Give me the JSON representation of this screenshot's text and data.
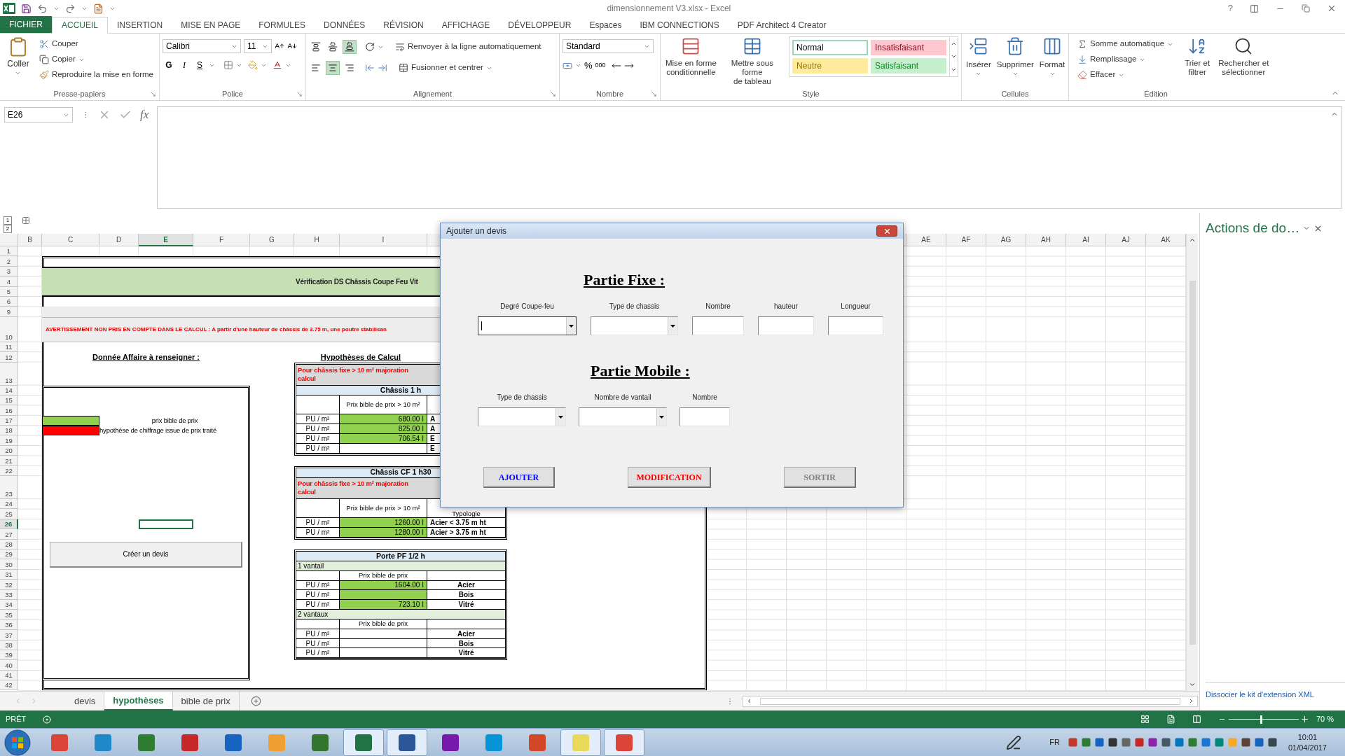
{
  "window": {
    "title": "dimensionnement V3.xlsx - Excel",
    "help": "?"
  },
  "ribbon_tabs": [
    {
      "label": "FICHIER",
      "kind": "file",
      "selected": false
    },
    {
      "label": "ACCUEIL",
      "kind": "tab",
      "selected": true
    },
    {
      "label": "INSERTION",
      "kind": "tab",
      "selected": false
    },
    {
      "label": "MISE EN PAGE",
      "kind": "tab",
      "selected": false
    },
    {
      "label": "FORMULES",
      "kind": "tab",
      "selected": false
    },
    {
      "label": "DONNÉES",
      "kind": "tab",
      "selected": false
    },
    {
      "label": "RÉVISION",
      "kind": "tab",
      "selected": false
    },
    {
      "label": "AFFICHAGE",
      "kind": "tab",
      "selected": false
    },
    {
      "label": "DÉVELOPPEUR",
      "kind": "tab",
      "selected": false
    },
    {
      "label": "Espaces",
      "kind": "tab",
      "selected": false
    },
    {
      "label": "IBM CONNECTIONS",
      "kind": "tab",
      "selected": false
    },
    {
      "label": "PDF Architect 4 Creator",
      "kind": "tab",
      "selected": false
    }
  ],
  "ribbon": {
    "clipboard": {
      "group": "Presse-papiers",
      "paste": "Coller",
      "cut": "Couper",
      "copy": "Copier",
      "format_painter": "Reproduire la mise en forme"
    },
    "font": {
      "group": "Police",
      "family": "Calibri",
      "size": "11",
      "bold": "G",
      "italic": "I",
      "underline": "S"
    },
    "alignment": {
      "group": "Alignement",
      "wrap": "Renvoyer à la ligne automatiquement",
      "merge": "Fusionner et centrer",
      "vertical": [
        {
          "selected": false
        },
        {
          "selected": false
        },
        {
          "selected": true
        }
      ],
      "horizontal": [
        {
          "selected": false
        },
        {
          "selected": true
        },
        {
          "selected": false
        }
      ]
    },
    "number": {
      "group": "Nombre",
      "format": "Standard",
      "percent": "%",
      "thousands": "000"
    },
    "style": {
      "group": "Style",
      "conditional": [
        "Mise en forme",
        "conditionnelle"
      ],
      "table": [
        "Mettre sous forme",
        "de tableau"
      ],
      "gallery": [
        {
          "label": "Normal",
          "color": "#ffffff",
          "selected": true
        },
        {
          "label": "Insatisfaisant",
          "color": "#ffc7ce",
          "selected": false
        },
        {
          "label": "Neutre",
          "color": "#ffeb9c",
          "selected": false
        },
        {
          "label": "Satisfaisant",
          "color": "#c6efce",
          "selected": false
        }
      ]
    },
    "cells": {
      "group": "Cellules",
      "insert": "Insérer",
      "delete": "Supprimer",
      "format": "Format"
    },
    "editing": {
      "group": "Édition",
      "autosum": "Somme automatique",
      "fill": "Remplissage",
      "clear": "Effacer",
      "sort": [
        "Trier et",
        "filtrer"
      ],
      "find": [
        "Rechercher et",
        "sélectionner"
      ]
    }
  },
  "formula_bar": {
    "name_box": "E26",
    "fx": "fx"
  },
  "outline_levels": [
    "1",
    "2"
  ],
  "sheet": {
    "columns": [
      {
        "label": "B",
        "selected": false
      },
      {
        "label": "C",
        "selected": false
      },
      {
        "label": "D",
        "selected": false
      },
      {
        "label": "E",
        "selected": true
      },
      {
        "label": "F",
        "selected": false
      },
      {
        "label": "G",
        "selected": false
      },
      {
        "label": "H",
        "selected": false
      },
      {
        "label": "I",
        "selected": false
      },
      {
        "label": "AE",
        "selected": false
      },
      {
        "label": "AF",
        "selected": false
      },
      {
        "label": "AG",
        "selected": false
      },
      {
        "label": "AH",
        "selected": false
      },
      {
        "label": "AI",
        "selected": false
      },
      {
        "label": "AJ",
        "selected": false
      },
      {
        "label": "AK",
        "selected": false
      }
    ],
    "rows": [
      {
        "label": "1",
        "selected": false
      },
      {
        "label": "2",
        "selected": false
      },
      {
        "label": "3",
        "selected": false
      },
      {
        "label": "4",
        "selected": false
      },
      {
        "label": "5",
        "selected": false
      },
      {
        "label": "6",
        "selected": false
      },
      {
        "label": "9",
        "selected": false
      },
      {
        "label": "10",
        "selected": false
      },
      {
        "label": "11",
        "selected": false
      },
      {
        "label": "12",
        "selected": false
      },
      {
        "label": "13",
        "selected": false
      },
      {
        "label": "14",
        "selected": false
      },
      {
        "label": "15",
        "selected": false
      },
      {
        "label": "16",
        "selected": false
      },
      {
        "label": "17",
        "selected": false
      },
      {
        "label": "18",
        "selected": false
      },
      {
        "label": "19",
        "selected": false
      },
      {
        "label": "20",
        "selected": false
      },
      {
        "label": "21",
        "selected": false
      },
      {
        "label": "22",
        "selected": false
      },
      {
        "label": "23",
        "selected": false
      },
      {
        "label": "24",
        "selected": false
      },
      {
        "label": "25",
        "selected": false
      },
      {
        "label": "26",
        "selected": true
      },
      {
        "label": "27",
        "selected": false
      },
      {
        "label": "28",
        "selected": false
      },
      {
        "label": "29",
        "selected": false
      },
      {
        "label": "30",
        "selected": false
      },
      {
        "label": "31",
        "selected": false
      },
      {
        "label": "32",
        "selected": false
      },
      {
        "label": "33",
        "selected": false
      },
      {
        "label": "34",
        "selected": false
      },
      {
        "label": "35",
        "selected": false
      },
      {
        "label": "36",
        "selected": false
      },
      {
        "label": "37",
        "selected": false
      },
      {
        "label": "38",
        "selected": false
      },
      {
        "label": "39",
        "selected": false
      },
      {
        "label": "40",
        "selected": false
      },
      {
        "label": "41",
        "selected": false
      },
      {
        "label": "42",
        "selected": false
      }
    ],
    "title_band": "Vérification DS Châssis Coupe Feu Vit",
    "warning": "AVERTISSEMENT NON PRIS EN COMPTE DANS LE CALCUL : A partir d'une hauteur de châssis de 3.75 m, une poutre stabilisan",
    "affaire_heading": "Donnée Affaire à renseigner :",
    "hypotheses_heading": "Hypothèses de Calcul",
    "legend": [
      {
        "color": "#92d050",
        "label": "prix bible de prix"
      },
      {
        "color": "#ff0000",
        "label": "hypothèse de chiffrage issue de prix traité"
      }
    ],
    "create_button": "Créer un devis",
    "tables": [
      {
        "kind": "price",
        "parts": [
          {
            "kind": "note",
            "lines": [
              "Pour châssis fixe > 10 m² majoration",
              "calcul"
            ]
          },
          {
            "kind": "title",
            "text": "Châssis 1 h"
          },
          {
            "kind": "header",
            "text": "Prix bible de prix > 10 m²"
          },
          {
            "kind": "row",
            "unit": "PU / m²",
            "value": "680.00 I",
            "type": "A",
            "color": "#92d050"
          },
          {
            "kind": "row",
            "unit": "PU / m²",
            "value": "825.00 I",
            "type": "A",
            "color": "#92d050"
          },
          {
            "kind": "row",
            "unit": "PU / m²",
            "value": "706.54 I",
            "type": "E",
            "color": "#92d050"
          },
          {
            "kind": "row",
            "unit": "PU / m²",
            "type": "E"
          }
        ]
      },
      {
        "kind": "price",
        "parts": [
          {
            "kind": "title",
            "text": "Châssis CF 1 h30"
          },
          {
            "kind": "note",
            "lines": [
              "Pour châssis fixe > 10 m² majoration",
              "calcul"
            ]
          },
          {
            "kind": "header",
            "text": "Prix bible de prix > 10 m²",
            "typology": "Typologie"
          },
          {
            "kind": "row",
            "unit": "PU / m²",
            "value": "1260.00 I",
            "type": "Acier < 3.75 m ht",
            "color": "#92d050"
          },
          {
            "kind": "row",
            "unit": "PU / m²",
            "value": "1280.00 I",
            "type": "Acier > 3.75 m ht",
            "color": "#92d050"
          }
        ]
      },
      {
        "kind": "door",
        "parts": [
          {
            "kind": "title",
            "text": "Porte PF 1/2 h"
          },
          {
            "kind": "section",
            "text": "1 vantail"
          },
          {
            "kind": "header",
            "text": "Prix bible de prix"
          },
          {
            "kind": "row",
            "unit": "PU / m²",
            "value": "1604.00 I",
            "type": "Acier",
            "color": "#92d050"
          },
          {
            "kind": "row",
            "unit": "PU / m²",
            "type": "Bois",
            "color": "#92d050"
          },
          {
            "kind": "row",
            "unit": "PU / m²",
            "value": "723.10 I",
            "type": "Vitré",
            "color": "#92d050"
          },
          {
            "kind": "section",
            "text": "2 vantaux"
          },
          {
            "kind": "header",
            "text": "Prix bible de prix"
          },
          {
            "kind": "row",
            "unit": "PU / m²",
            "type": "Acier"
          },
          {
            "kind": "row",
            "unit": "PU / m²",
            "type": "Bois"
          },
          {
            "kind": "row",
            "unit": "PU / m²",
            "type": "Vitré"
          }
        ]
      }
    ]
  },
  "dialog": {
    "title": "Ajouter un devis",
    "sections": [
      {
        "heading": "Partie Fixe :",
        "fields": [
          {
            "label": "Degré Coupe-feu",
            "kind": "combo",
            "focused": true
          },
          {
            "label": "Type de chassis",
            "kind": "combo",
            "focused": false
          },
          {
            "label": "Nombre",
            "kind": "text",
            "focused": false
          },
          {
            "label": "hauteur",
            "kind": "text",
            "focused": false
          },
          {
            "label": "Longueur",
            "kind": "text",
            "focused": false
          }
        ]
      },
      {
        "heading": "Partie Mobile :",
        "fields": [
          {
            "label": "Type de chassis",
            "kind": "combo",
            "focused": false
          },
          {
            "label": "Nombre de vantail",
            "kind": "combo",
            "focused": false
          },
          {
            "label": "Nombre",
            "kind": "text",
            "focused": false
          }
        ]
      }
    ],
    "buttons": [
      {
        "label": "AJOUTER",
        "color": "#0000ff"
      },
      {
        "label": "MODIFICATION",
        "color": "#ff0000"
      },
      {
        "label": "SORTIR",
        "color": "#7f7f7f"
      }
    ]
  },
  "task_pane": {
    "title": "Actions de do…",
    "link": "Dissocier le kit d'extension XML"
  },
  "sheet_tabs": [
    {
      "label": "devis",
      "selected": false
    },
    {
      "label": "hypothèses",
      "selected": true
    },
    {
      "label": "bible de prix",
      "selected": false
    }
  ],
  "status_bar": {
    "ready": "PRÊT",
    "zoom": "70 %",
    "zoom_slider": {
      "level": 0.45
    }
  },
  "taskbar": {
    "apps": [
      {
        "color": "#db4437",
        "running": false
      },
      {
        "color": "#1e88c8",
        "running": false
      },
      {
        "color": "#2e7d32",
        "running": false
      },
      {
        "color": "#c62828",
        "running": false
      },
      {
        "color": "#1565c0",
        "running": false
      },
      {
        "color": "#f0a030",
        "running": false
      },
      {
        "color": "#31752f",
        "running": false
      },
      {
        "color": "#217346",
        "running": true
      },
      {
        "color": "#2b579a",
        "running": true
      },
      {
        "color": "#7719aa",
        "running": false
      },
      {
        "color": "#0696d7",
        "running": false
      },
      {
        "color": "#d24726",
        "running": false
      },
      {
        "color": "#e8d95a",
        "running": true
      },
      {
        "color": "#db4437",
        "running": true
      }
    ],
    "language": "FR",
    "time": "10:01",
    "date": "01/04/2017"
  }
}
